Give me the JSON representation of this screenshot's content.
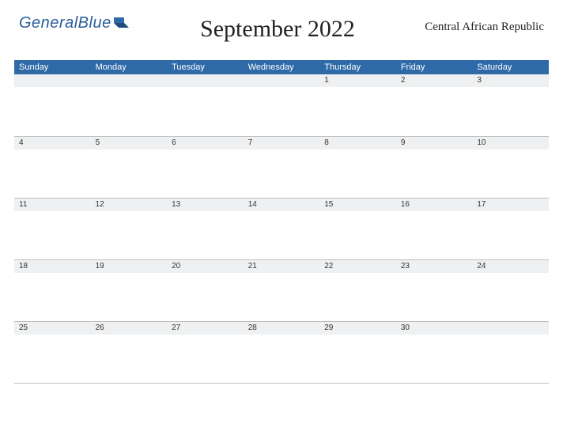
{
  "brand": {
    "part1": "General",
    "part2": "Blue"
  },
  "title": "September 2022",
  "region": "Central African Republic",
  "weekdays": [
    "Sunday",
    "Monday",
    "Tuesday",
    "Wednesday",
    "Thursday",
    "Friday",
    "Saturday"
  ],
  "weeks": [
    [
      "",
      "",
      "",
      "",
      "1",
      "2",
      "3"
    ],
    [
      "4",
      "5",
      "6",
      "7",
      "8",
      "9",
      "10"
    ],
    [
      "11",
      "12",
      "13",
      "14",
      "15",
      "16",
      "17"
    ],
    [
      "18",
      "19",
      "20",
      "21",
      "22",
      "23",
      "24"
    ],
    [
      "25",
      "26",
      "27",
      "28",
      "29",
      "30",
      ""
    ]
  ]
}
